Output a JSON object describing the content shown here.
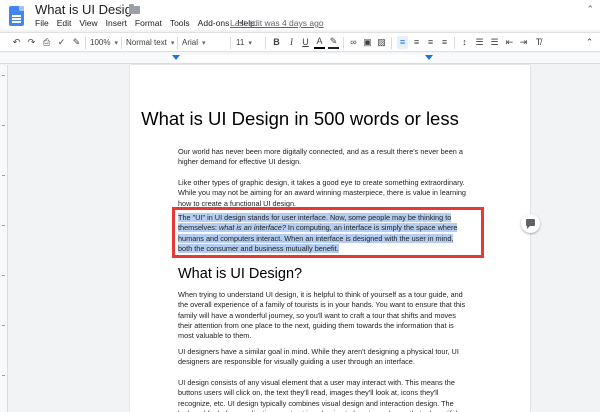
{
  "window": {
    "title": "What is UI Design",
    "last_edit": "Last edit was 4 days ago"
  },
  "menu": [
    "File",
    "Edit",
    "View",
    "Insert",
    "Format",
    "Tools",
    "Add-ons",
    "Help"
  ],
  "toolbar": {
    "zoom": "100%",
    "style": "Normal text",
    "font": "Arial",
    "size": "11",
    "bold": "B",
    "italic": "I",
    "underline": "U",
    "text_color": "A"
  },
  "document": {
    "title": "What is UI Design in 500 words or less",
    "paragraphs": [
      "Our world has never been more digitally connected, and as a result there's never been a higher demand for effective UI design.",
      "Like other types of graphic design, it takes a good eye to create something extraordinary. While you may not be aiming for an award winning masterpiece, there is value in learning how to create a functional UI design."
    ],
    "highlighted_before": "The \"UI\" in UI design stands for user interface. Now, some people may be thinking to themselves: ",
    "highlighted_em": "what is an interface?",
    "highlighted_after": " In computing, an interface is simply the space where humans and computers interact. When an interface is designed with the user in mind, both the consumer and business mutually benefit.",
    "heading2": "What is UI Design?",
    "paragraphs2": [
      "When trying to understand UI design, it is helpful to think of yourself as a tour guide, and the overall experience of a family of tourists is in your hands. You want to ensure that this family will have a wonderful journey, so you'll want to craft a tour that shifts and moves their attention from one place to the next, guiding them towards the information that is most valuable to them.",
      "UI designers have a similar goal in mind. While they aren't designing a physical tour, UI designers are responsible for visually guiding a user through an interface.",
      "UI design consists of any visual element that a user may interact with. This means the buttons users will click on, the text they'll read, images they'll look at, icons they'll recognize, etc. UI design typically combines visual design and interaction design. The look and feel of an application must act in cohesion to how to works, so that a beautiful, engaging, and"
    ]
  },
  "colors": {
    "highlight": "#b4cdf0",
    "annotation_box": "#e53935",
    "accent": "#1a73e8"
  }
}
